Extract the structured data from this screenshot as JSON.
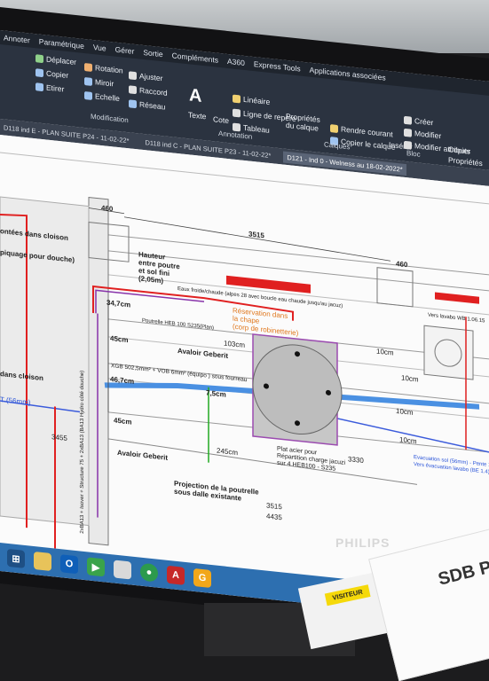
{
  "menu": [
    "Annoter",
    "Paramétrique",
    "Vue",
    "Gérer",
    "Sortie",
    "Compléments",
    "A360",
    "Express Tools",
    "Applications associées"
  ],
  "tools": {
    "deplacer": "Déplacer",
    "rotation": "Rotation",
    "ajuster": "Ajuster",
    "copier": "Copier",
    "miroir": "Miroir",
    "raccord": "Raccord",
    "etirer": "Etirer",
    "echelle": "Echelle",
    "reseau": "Réseau",
    "texte": "Texte",
    "cote": "Cote",
    "lineaire": "Linéaire",
    "ligne_repere": "Ligne de repère",
    "tableau": "Tableau",
    "proprietes": "Propriétés du calque",
    "rendre_courant": "Rendre courant",
    "copier_calque": "Copier le calque",
    "inserer": "Insérer",
    "creer": "Créer",
    "modifier": "Modifier",
    "modifier_attributs": "Modifier attributs",
    "copier2": "Copier",
    "proprietes2": "Propriétés"
  },
  "groups": {
    "modification": "Modification",
    "annotation": "Annotation",
    "calques": "Calques",
    "bloc": "Bloc"
  },
  "tabs": [
    {
      "label": "D118 ind E - PLAN SUITE P24 - 11-02-22*",
      "active": false
    },
    {
      "label": "D118 ind C - PLAN SUITE P23 - 11-02-22*",
      "active": false
    },
    {
      "label": "D121 - Ind 0 - Welness au 18-02-2022*",
      "active": true
    }
  ],
  "drawing": {
    "dim_top_460": "460",
    "dim_top_3515": "3515",
    "dim_top_460b": "460",
    "hauteur": "Hauteur\nentre poutre\net sol fini\n(2,05m)",
    "eaux": "Eaux froide/chaude (alpes 28 avec boucle eau chaude jusqu'au jacuz)",
    "montees": "ontées dans cloison",
    "piquage": "piquage pour douche)",
    "reservation": "Réservation dans\nla chape\n(corp de robinetterie)",
    "dans_cloison": "dans cloison",
    "t56": "T (56mm)",
    "d347": "34,7cm",
    "d45a": "45cm",
    "d467": "46,7cm",
    "d45b": "45cm",
    "d103": "103cm",
    "d75": "7,5cm",
    "d245": "245cm",
    "d10a": "10cm",
    "d10b": "10cm",
    "d10c": "10cm",
    "d10d": "10cm",
    "avaloir1": "Avaloir Geberit",
    "avaloir2": "Avaloir Geberit",
    "plat": "Plat acier pour\nRépartition charge jacuzi\nsur 4 HEB100 - S235",
    "projection": "Projection de la poutrelle\nsous dalle existante",
    "d3455": "3455",
    "d3330": "3330",
    "d3515b": "3515",
    "d4435": "4435",
    "evacuation": "Evacuation sol (56mm) - Pente 1%",
    "evac2": "Vers évacuation lavabo (BE 1.4)",
    "vers": "Vers lavabo WB 1.06.15",
    "xgb": "XGB 502,5mm² + VOB 6mm² (équipo ) sous fourreau",
    "poutrelle": "Poutrelle HEB 100 S235(Plan)",
    "cloison": "2xBA13 + Isover + Structure 75 + 2xBA13\n(BA13 Hydro côté douche)",
    "cloison2": "2xBA13 + Isover + Structure 75 + 2xBA13 (BA13 Hydro côté douche)"
  },
  "taskbar": [
    "start",
    "explorer",
    "outlook",
    "media",
    "files",
    "chrome",
    "autocad",
    "gmail"
  ],
  "monitor_brand": "PHILIPS",
  "badge": "VISITEUR",
  "paper_text": "SDB P2"
}
